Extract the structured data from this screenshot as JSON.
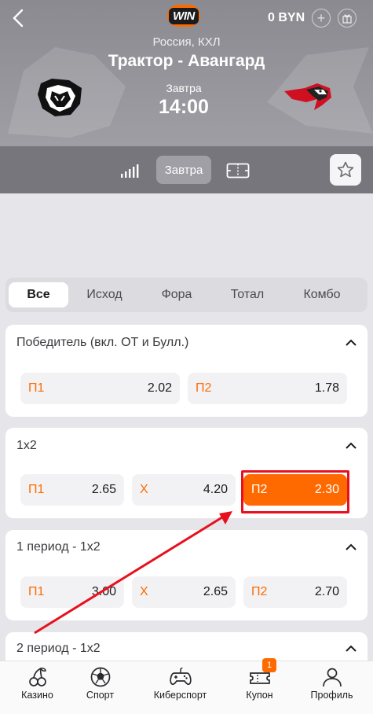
{
  "header": {
    "balance": "0 BYN",
    "league": "Россия, КХЛ",
    "match_title": "Трактор - Авангард",
    "day": "Завтра",
    "time": "14:00",
    "logo_text": "WIN",
    "icons": [
      "back-icon",
      "plus-icon",
      "gift-icon"
    ]
  },
  "toolbar": {
    "active_tab": "Завтра",
    "icons": [
      "stats-icon",
      "field-icon",
      "star-icon"
    ]
  },
  "market_tabs": [
    "Все",
    "Исход",
    "Фора",
    "Тотал",
    "Комбо"
  ],
  "markets": [
    {
      "title": "Победитель (вкл. ОТ и Булл.)",
      "odds": [
        {
          "label": "П1",
          "value": "2.02"
        },
        {
          "label": "П2",
          "value": "1.78"
        }
      ]
    },
    {
      "title": "1x2",
      "odds": [
        {
          "label": "П1",
          "value": "2.65"
        },
        {
          "label": "Х",
          "value": "4.20"
        },
        {
          "label": "П2",
          "value": "2.30",
          "selected": true
        }
      ]
    },
    {
      "title": "1 период - 1x2",
      "odds": [
        {
          "label": "П1",
          "value": "3.00"
        },
        {
          "label": "Х",
          "value": "2.65"
        },
        {
          "label": "П2",
          "value": "2.70"
        }
      ]
    },
    {
      "title": "2 период - 1x2"
    }
  ],
  "bottom_nav": [
    {
      "label": "Казино",
      "icon": "cherry-icon"
    },
    {
      "label": "Спорт",
      "icon": "ball-icon"
    },
    {
      "label": "Киберспорт",
      "icon": "gamepad-icon"
    },
    {
      "label": "Купон",
      "icon": "coupon-icon"
    },
    {
      "label": "Профиль",
      "icon": "profile-icon"
    }
  ],
  "coupon_badge": "1",
  "colors": {
    "accent": "#ff6a00",
    "highlight": "#e8101e"
  }
}
